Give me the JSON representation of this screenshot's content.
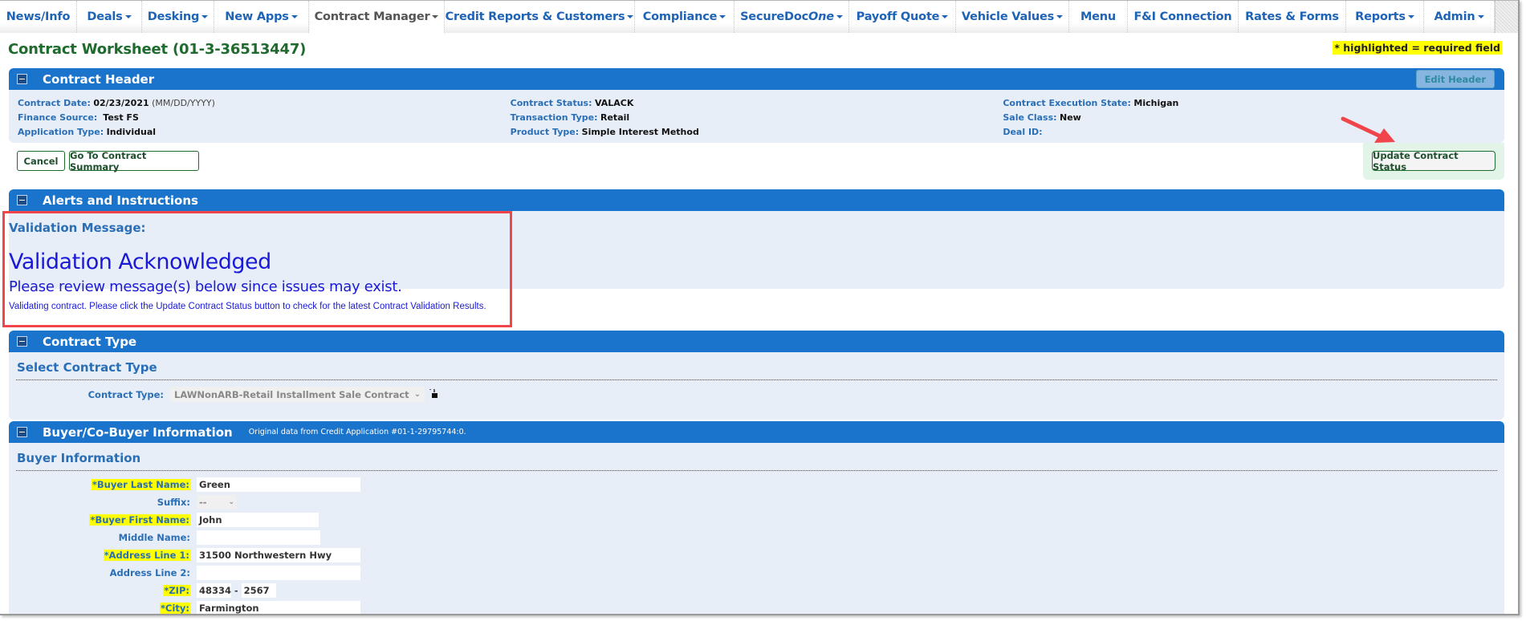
{
  "nav": {
    "tabs": [
      {
        "label": "News/Info",
        "dropdown": false,
        "active": false
      },
      {
        "label": "Deals",
        "dropdown": true,
        "active": false
      },
      {
        "label": "Desking",
        "dropdown": true,
        "active": false
      },
      {
        "label": "New Apps",
        "dropdown": true,
        "active": false
      },
      {
        "label": "Contract Manager",
        "dropdown": true,
        "active": true
      },
      {
        "label": "Credit Reports & Customers",
        "dropdown": true,
        "active": false
      },
      {
        "label": "Compliance",
        "dropdown": true,
        "active": false
      },
      {
        "label": "SecureDoc",
        "label_italic": "One",
        "dropdown": true,
        "active": false
      },
      {
        "label": "Payoff Quote",
        "dropdown": true,
        "active": false
      },
      {
        "label": "Vehicle Values",
        "dropdown": true,
        "active": false
      },
      {
        "label": "Menu",
        "dropdown": false,
        "active": false
      },
      {
        "label": "F&I Connection",
        "dropdown": false,
        "active": false
      },
      {
        "label": "Rates & Forms",
        "dropdown": false,
        "active": false
      },
      {
        "label": "Reports",
        "dropdown": true,
        "active": false
      },
      {
        "label": "Admin",
        "dropdown": true,
        "active": false
      }
    ]
  },
  "page": {
    "title": "Contract Worksheet (01-3-36513447)",
    "required_note": "* highlighted = required field"
  },
  "contract_header": {
    "title": "Contract Header",
    "edit_button": "Edit Header",
    "columns": [
      [
        {
          "label": "Contract Date:",
          "value": "02/23/2021",
          "hint": "(MM/DD/YYYY)"
        },
        {
          "label": "Finance Source:",
          "value": "Test FS"
        },
        {
          "label": "Application Type:",
          "value": "Individual"
        }
      ],
      [
        {
          "label": "Contract Status:",
          "value": "VALACK"
        },
        {
          "label": "Transaction Type:",
          "value": "Retail"
        },
        {
          "label": "Product Type:",
          "value": "Simple Interest Method"
        }
      ],
      [
        {
          "label": "Contract Execution State:",
          "value": "Michigan"
        },
        {
          "label": "Sale Class:",
          "value": "New"
        },
        {
          "label": "Deal ID:",
          "value": ""
        }
      ]
    ]
  },
  "actions": {
    "cancel": "Cancel",
    "go_to_summary": "Go To Contract Summary",
    "update_status": "Update Contract Status"
  },
  "alerts": {
    "title": "Alerts and Instructions",
    "validation_label": "Validation Message:",
    "validation_heading": "Validation Acknowledged",
    "validation_sub": "Please review message(s) below since issues may exist.",
    "validation_detail": "Validating contract. Please click the Update Contract Status button to check for the latest Contract Validation Results."
  },
  "contract_type": {
    "title": "Contract Type",
    "section_heading": "Select Contract Type",
    "field_label": "Contract Type:",
    "selected": "LAWNonARB-Retail Installment Sale Contract",
    "lock_icon": "unlocked-padlock"
  },
  "buyer": {
    "title": "Buyer/Co-Buyer Information",
    "note": "Original data from Credit Application #01-1-29795744:0.",
    "section_heading": "Buyer Information",
    "fields": {
      "last_name": {
        "label": "*Buyer Last Name:",
        "value": "Green",
        "required": true
      },
      "suffix": {
        "label": "Suffix:",
        "value": "--",
        "required": false
      },
      "first_name": {
        "label": "*Buyer First Name:",
        "value": "John",
        "required": true
      },
      "middle_name": {
        "label": "Middle Name:",
        "value": "",
        "required": false
      },
      "address1": {
        "label": "*Address Line 1:",
        "value": "31500 Northwestern Hwy",
        "required": true
      },
      "address2": {
        "label": "Address Line 2:",
        "value": "",
        "required": false
      },
      "zip": {
        "label": "*ZIP:",
        "value": "48334",
        "ext": "2567",
        "separator": "-",
        "required": true
      },
      "city": {
        "label": "*City:",
        "value": "Farmington",
        "required": true
      }
    }
  },
  "colors": {
    "nav_text": "#1e63b5",
    "panel_bar": "#1b74cc",
    "panel_body": "#e8eef7",
    "title_green": "#1f6b2e",
    "label_blue": "#2a6fb6",
    "validation_blue": "#1a1ad6",
    "required_highlight": "#ffff00",
    "annotation_red": "#f0454a"
  }
}
